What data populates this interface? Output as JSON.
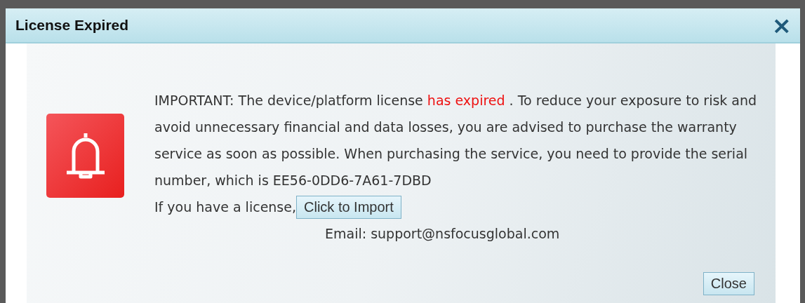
{
  "dialog": {
    "title": "License Expired",
    "close_icon": "×",
    "message": {
      "before": "IMPORTANT: The device/platform license ",
      "highlight": "has expired",
      "after": " . To reduce your exposure to risk and avoid unnecessary financial and data losses, you are advised to purchase the warranty service as soon as possible. When purchasing the service, you need to provide the serial number, which is EE56-0DD6-7A61-7DBD"
    },
    "import_prompt": "If you have a license,",
    "import_button": "Click to Import",
    "email": "Email: support@nsfocusglobal.com",
    "buttons": [
      "Close"
    ]
  }
}
